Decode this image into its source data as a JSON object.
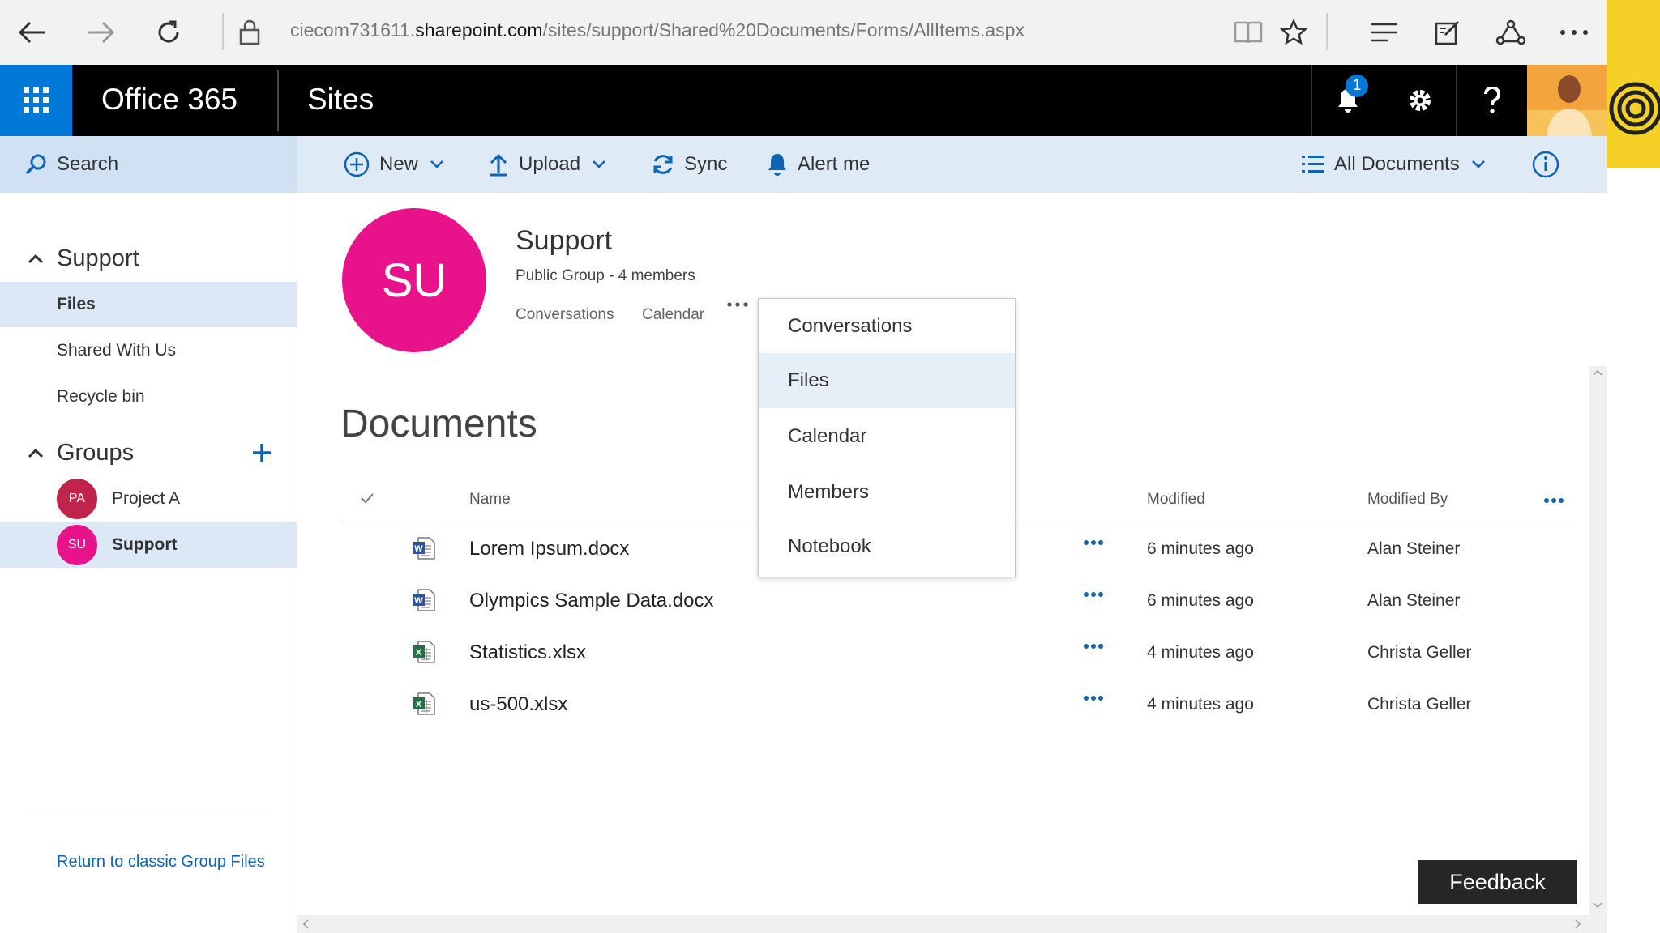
{
  "browser": {
    "url_prefix": "ciecom731611.",
    "url_domain": "sharepoint.com",
    "url_path": "/sites/support/Shared%20Documents/Forms/AllItems.aspx"
  },
  "suite": {
    "app_name": "Office 365",
    "section": "Sites",
    "notification_count": "1"
  },
  "commandbar": {
    "search_label": "Search",
    "new_label": "New",
    "upload_label": "Upload",
    "sync_label": "Sync",
    "alert_label": "Alert me",
    "view_label": "All Documents"
  },
  "nav": {
    "site_header": "Support",
    "items": [
      {
        "label": "Files"
      },
      {
        "label": "Shared With Us"
      },
      {
        "label": "Recycle bin"
      }
    ],
    "groups_header": "Groups",
    "groups": [
      {
        "initials": "PA",
        "label": "Project A",
        "color": "#c0244c"
      },
      {
        "initials": "SU",
        "label": "Support",
        "color": "#e8128b"
      }
    ],
    "return_link": "Return to classic Group Files"
  },
  "group": {
    "initials": "SU",
    "title": "Support",
    "subtitle": "Public Group - 4 members",
    "links": [
      "Conversations",
      "Calendar"
    ]
  },
  "documents": {
    "title": "Documents",
    "columns": {
      "name": "Name",
      "modified": "Modified",
      "modified_by": "Modified By"
    },
    "rows": [
      {
        "type": "word",
        "name": "Lorem Ipsum.docx",
        "modified": "6 minutes ago",
        "modified_by": "Alan Steiner"
      },
      {
        "type": "word",
        "name": "Olympics Sample Data.docx",
        "modified": "6 minutes ago",
        "modified_by": "Alan Steiner"
      },
      {
        "type": "excel",
        "name": "Statistics.xlsx",
        "modified": "4 minutes ago",
        "modified_by": "Christa Geller"
      },
      {
        "type": "excel",
        "name": "us-500.xlsx",
        "modified": "4 minutes ago",
        "modified_by": "Christa Geller"
      }
    ]
  },
  "dropdown": {
    "items": [
      "Conversations",
      "Files",
      "Calendar",
      "Members",
      "Notebook"
    ],
    "selected": "Files"
  },
  "feedback_label": "Feedback",
  "colors": {
    "suite_bar": "#000000",
    "waffle": "#0078d7",
    "accent": "#0078d7",
    "group_avatar": "#e8128b",
    "selection": "#dce8f6"
  }
}
